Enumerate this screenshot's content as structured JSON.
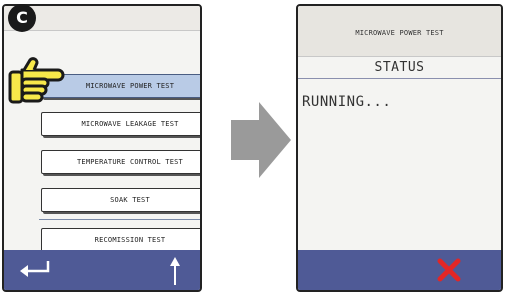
{
  "badge": {
    "letter": "C"
  },
  "left_screen": {
    "menu_items": [
      {
        "label": "MICROWAVE POWER TEST",
        "selected": true
      },
      {
        "label": "MICROWAVE LEAKAGE TEST",
        "selected": false
      },
      {
        "label": "TEMPERATURE CONTROL TEST",
        "selected": false
      },
      {
        "label": "SOAK TEST",
        "selected": false
      },
      {
        "label": "RECOMISSION TEST",
        "selected": false
      }
    ],
    "icons": {
      "back": "return-arrow-icon",
      "up": "up-arrow-icon"
    }
  },
  "flow_arrow": {
    "icon": "right-arrow-icon"
  },
  "right_screen": {
    "title": "MICROWAVE POWER TEST",
    "status_label": "STATUS",
    "status_text": "RUNNING...",
    "icons": {
      "cancel": "cancel-x-icon"
    }
  },
  "colors": {
    "bottom_bar": "#4f5a96",
    "selected_button": "#b9cbe6",
    "hand_fill": "#f7e84a",
    "cancel_x": "#e22626",
    "flow_arrow": "#9a9a9a"
  }
}
